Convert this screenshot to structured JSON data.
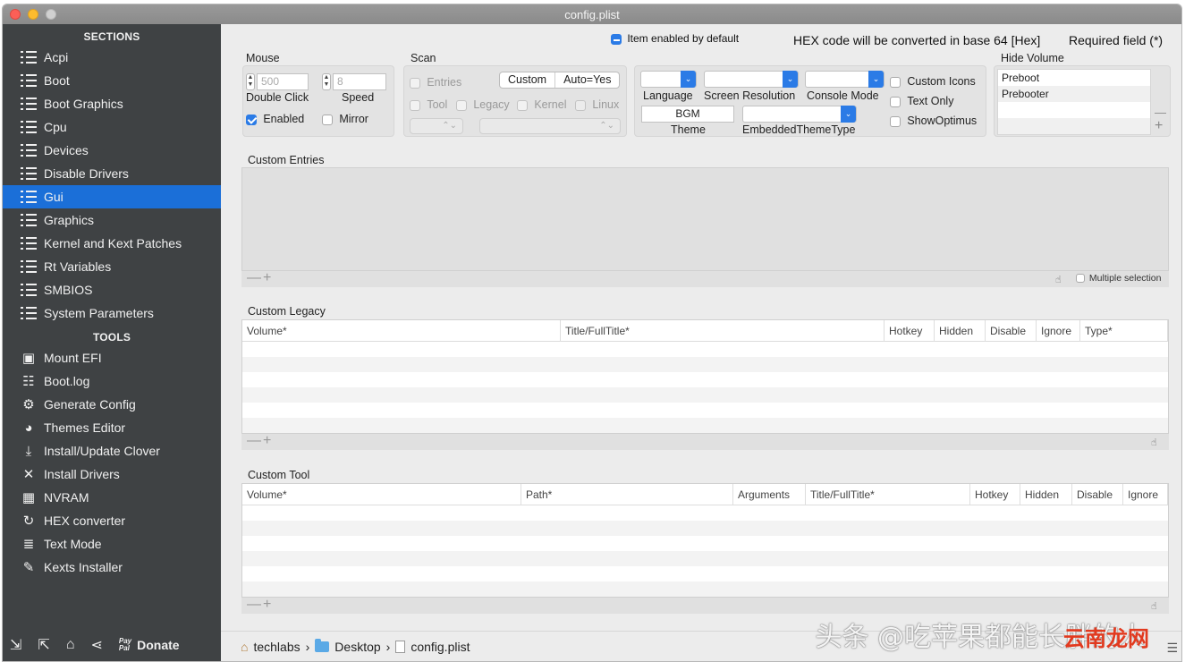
{
  "window": {
    "title": "config.plist"
  },
  "sidebar": {
    "sections_header": "SECTIONS",
    "sections": [
      {
        "label": "Acpi",
        "selected": false
      },
      {
        "label": "Boot",
        "selected": false
      },
      {
        "label": "Boot Graphics",
        "selected": false
      },
      {
        "label": "Cpu",
        "selected": false
      },
      {
        "label": "Devices",
        "selected": false
      },
      {
        "label": "Disable Drivers",
        "selected": false
      },
      {
        "label": "Gui",
        "selected": true
      },
      {
        "label": "Graphics",
        "selected": false
      },
      {
        "label": "Kernel and Kext Patches",
        "selected": false
      },
      {
        "label": "Rt Variables",
        "selected": false
      },
      {
        "label": "SMBIOS",
        "selected": false
      },
      {
        "label": "System Parameters",
        "selected": false
      }
    ],
    "tools_header": "TOOLS",
    "tools": [
      {
        "label": "Mount EFI",
        "icon": "disk-icon"
      },
      {
        "label": "Boot.log",
        "icon": "log-icon"
      },
      {
        "label": "Generate Config",
        "icon": "gears-icon"
      },
      {
        "label": "Themes Editor",
        "icon": "palette-icon"
      },
      {
        "label": "Install/Update Clover",
        "icon": "download-icon"
      },
      {
        "label": "Install Drivers",
        "icon": "tools-icon"
      },
      {
        "label": "NVRAM",
        "icon": "chip-icon"
      },
      {
        "label": "HEX converter",
        "icon": "refresh-icon"
      },
      {
        "label": "Text Mode",
        "icon": "text-icon"
      },
      {
        "label": "Kexts Installer",
        "icon": "plug-icon"
      }
    ],
    "bottom": {
      "donate_label": "Donate",
      "paypal_top": "Pay",
      "paypal_bottom": "Pal"
    }
  },
  "top_info": {
    "item_enabled_label": "Item enabled by default",
    "hex_note": "HEX code will be converted in base 64 [Hex]",
    "required_note": "Required field (*)"
  },
  "mouse": {
    "label": "Mouse",
    "double_click_value": "500",
    "double_click_label": "Double Click",
    "speed_value": "8",
    "speed_label": "Speed",
    "enabled_label": "Enabled",
    "enabled_checked": true,
    "mirror_label": "Mirror",
    "mirror_checked": false
  },
  "scan": {
    "label": "Scan",
    "entries_label": "Entries",
    "custom_label": "Custom",
    "autoyes_label": "Auto=Yes",
    "tool_label": "Tool",
    "legacy_label": "Legacy",
    "kernel_label": "Kernel",
    "linux_label": "Linux"
  },
  "appearance": {
    "language_label": "Language",
    "screen_resolution_label": "Screen Resolution",
    "console_mode_label": "Console Mode",
    "theme_value": "BGM",
    "theme_label": "Theme",
    "embedded_theme_label": "EmbeddedThemeType",
    "custom_icons_label": "Custom Icons",
    "text_only_label": "Text Only",
    "show_optimus_label": "ShowOptimus"
  },
  "hide_volume": {
    "label": "Hide Volume",
    "items": [
      "Preboot",
      "Prebooter"
    ],
    "minus": "—",
    "plus": "+"
  },
  "custom_entries": {
    "label": "Custom Entries",
    "multiple_selection_label": "Multiple selection"
  },
  "custom_legacy": {
    "label": "Custom Legacy",
    "columns": [
      "Volume*",
      "Title/FullTitle*",
      "Hotkey",
      "Hidden",
      "Disable",
      "Ignore",
      "Type*"
    ]
  },
  "custom_tool": {
    "label": "Custom Tool",
    "columns": [
      "Volume*",
      "Path*",
      "Arguments",
      "Title/FullTitle*",
      "Hotkey",
      "Hidden",
      "Disable",
      "Ignore"
    ]
  },
  "breadcrumb": {
    "items": [
      "techlabs",
      "Desktop",
      "config.plist"
    ],
    "separator": "›"
  },
  "watermark": {
    "text": "头条 @吃苹果都能长胖的人",
    "brand": "云南龙网"
  },
  "colors": {
    "selection": "#1b6fd8",
    "sidebar": "#3f4244",
    "accent": "#2b7be6"
  }
}
